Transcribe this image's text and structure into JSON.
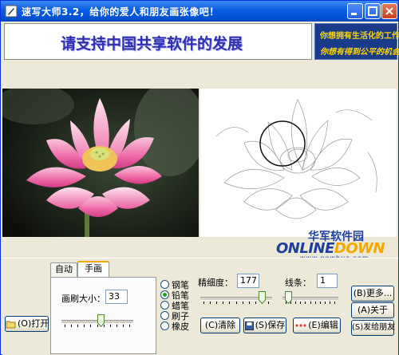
{
  "window": {
    "title": "速写大师3.2，给你的爱人和朋友画张像吧！",
    "controls": [
      "minimize",
      "maximize",
      "close"
    ]
  },
  "banner": {
    "left_text": "请支持中国共享软件的发展",
    "right_line1": "你想拥有生活化的工作吗?",
    "right_line2": "你想有得到公平的机会吗?"
  },
  "watermark": {
    "cn": "华军软件园",
    "en_prefix": "ONLINE",
    "en_suffix": "DOWN",
    "url": "www.newhua.com"
  },
  "controls": {
    "open_button": "(O)打开",
    "tabs": [
      {
        "label": "自动",
        "active": false
      },
      {
        "label": "手画",
        "active": true
      }
    ],
    "brush_size_label": "画刷大小：",
    "brush_size_value": "33",
    "brush_slider_fraction": 0.55,
    "tools": [
      {
        "label": "钢笔",
        "selected": false
      },
      {
        "label": "铅笔",
        "selected": true
      },
      {
        "label": "蜡笔",
        "selected": false
      },
      {
        "label": "刷子",
        "selected": false
      },
      {
        "label": "橡皮",
        "selected": false
      }
    ],
    "fineness_label": "精细度：",
    "fineness_value": "177",
    "fineness_slider_fraction": 0.9,
    "lines_label": "线条：",
    "lines_value": "1",
    "lines_slider_fraction": 0.05,
    "clear_button": "(C)清除",
    "save_button": "(S)保存",
    "edit_button": "(E)编辑",
    "more_button": "(B)更多...",
    "about_button": "(A)关于",
    "send_button": "(S)发给朋友"
  }
}
